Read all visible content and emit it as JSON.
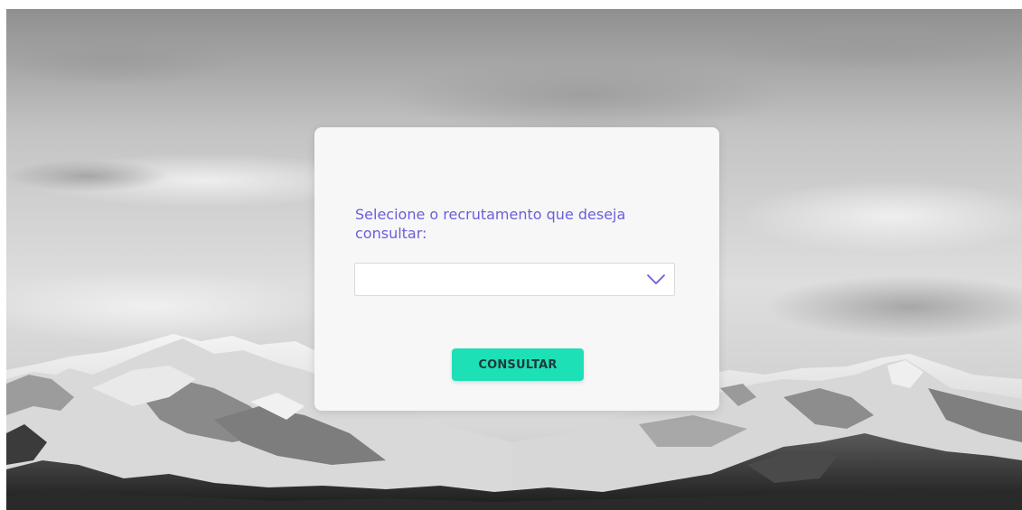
{
  "form": {
    "prompt": "Selecione o recrutamento que deseja consultar:",
    "select_value": "",
    "submit_label": "CONSULTAR"
  },
  "icons": {
    "dropdown": "chevron-down-icon"
  },
  "colors": {
    "prompt_text": "#6a5fd9",
    "chevron": "#6a5fd9",
    "button_bg": "#1ee0b6",
    "button_text": "#1d3b3a",
    "card_bg": "#f7f7f8"
  }
}
